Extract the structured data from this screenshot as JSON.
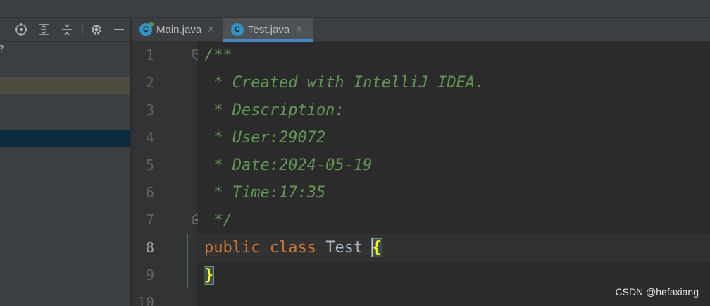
{
  "tabs": [
    {
      "label": "Main.java",
      "active": false
    },
    {
      "label": "Test.java",
      "active": true
    }
  ],
  "toolbar_icons": [
    "crosshair-icon",
    "expand-all-icon",
    "collapse-all-icon",
    "gear-icon",
    "minimize-icon"
  ],
  "sidebar": {
    "partial_glyph": "?"
  },
  "gutter": {
    "lines": [
      "1",
      "2",
      "3",
      "4",
      "5",
      "6",
      "7",
      "8",
      "9",
      "10"
    ],
    "current_line": "8"
  },
  "code": {
    "lines": [
      "/**",
      " * Created with IntelliJ IDEA.",
      " * Description:",
      " * User:29072",
      " * Date:2024-05-19",
      " * Time:17:35",
      " */"
    ],
    "line8": {
      "kw1": "public",
      "kw2": "class",
      "name": "Test",
      "brace_open": "{"
    },
    "line9": {
      "brace_close": "}"
    }
  },
  "colors": {
    "background": "#2b2b2b",
    "comment": "#629755",
    "keyword": "#cc7832",
    "identifier": "#a9b7c6",
    "brace": "#ffef28",
    "accent": "#4a88c7"
  },
  "watermark": "CSDN @hefaxiang"
}
